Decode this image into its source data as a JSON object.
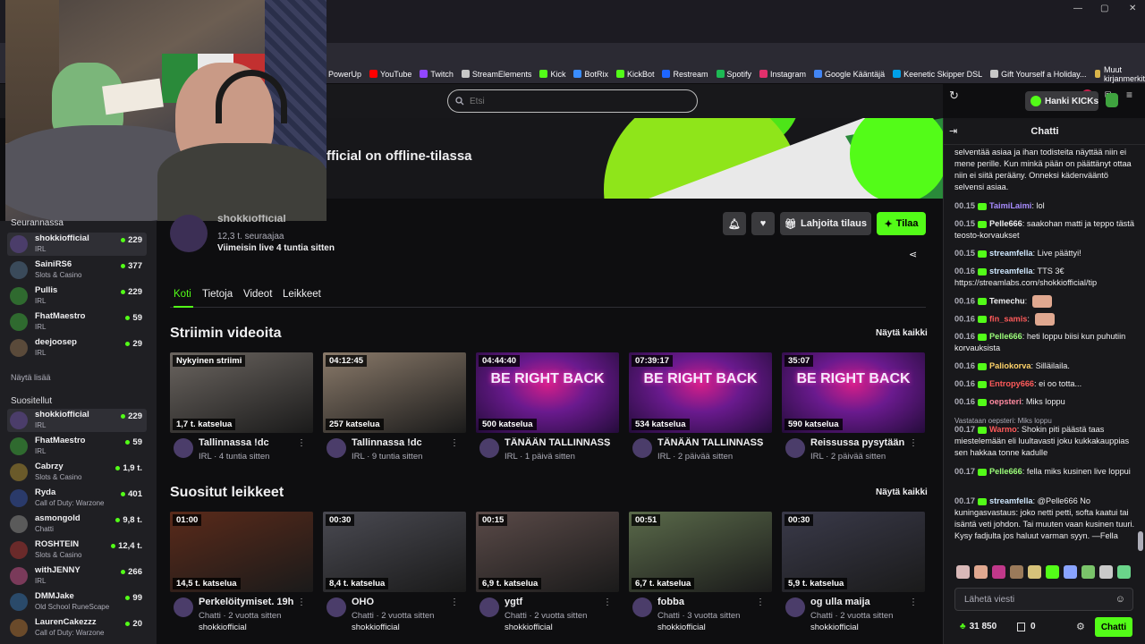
{
  "bookmarks": [
    {
      "label": "PowerUp",
      "color": "#f5a623"
    },
    {
      "label": "YouTube",
      "color": "#ff0000"
    },
    {
      "label": "Twitch",
      "color": "#9146ff"
    },
    {
      "label": "StreamElements",
      "color": "#c7c7c7"
    },
    {
      "label": "Kick",
      "color": "#53fc18"
    },
    {
      "label": "BotRix",
      "color": "#3a8dff"
    },
    {
      "label": "KickBot",
      "color": "#53fc18"
    },
    {
      "label": "Restream",
      "color": "#1e66ff"
    },
    {
      "label": "Spotify",
      "color": "#1db954"
    },
    {
      "label": "Instagram",
      "color": "#e1306c"
    },
    {
      "label": "Google Kääntäjä",
      "color": "#4285f4"
    },
    {
      "label": "Keenetic Skipper DSL",
      "color": "#00a0e9"
    },
    {
      "label": "Gift Yourself a Holiday...",
      "color": "#c7c7c7"
    }
  ],
  "bookmarks_other": "Muut kirjanmerkit",
  "ext_badge": "10",
  "search": {
    "placeholder": "Etsi"
  },
  "header": {
    "kicks_label": "Hanki KICKs"
  },
  "sidebar": {
    "following_title": "Seurannassa",
    "following": [
      {
        "name": "shokkiofficial",
        "category": "IRL",
        "viewers": "229",
        "color": "#4b3d6a"
      },
      {
        "name": "SainiRS6",
        "category": "Slots & Casino",
        "viewers": "377",
        "color": "#3a4a5a"
      },
      {
        "name": "Pullis",
        "category": "IRL",
        "viewers": "229",
        "color": "#2f6a2f"
      },
      {
        "name": "FhatMaestro",
        "category": "IRL",
        "viewers": "59",
        "color": "#2f6a2f"
      },
      {
        "name": "deejoosep",
        "category": "IRL",
        "viewers": "29",
        "color": "#5a4a3a"
      }
    ],
    "show_more": "Näytä lisää",
    "recommended_title": "Suositellut",
    "recommended": [
      {
        "name": "shokkiofficial",
        "category": "IRL",
        "viewers": "229",
        "color": "#4b3d6a"
      },
      {
        "name": "FhatMaestro",
        "category": "IRL",
        "viewers": "59",
        "color": "#2f6a2f"
      },
      {
        "name": "Cabrzy",
        "category": "Slots & Casino",
        "viewers": "1,9 t.",
        "color": "#6a5a2a"
      },
      {
        "name": "Ryda",
        "category": "Call of Duty: Warzone",
        "viewers": "401",
        "color": "#2a3a6a"
      },
      {
        "name": "asmongold",
        "category": "Chatti",
        "viewers": "9,8 t.",
        "color": "#5a5a5a"
      },
      {
        "name": "ROSHTEIN",
        "category": "Slots & Casino",
        "viewers": "12,4 t.",
        "color": "#6a2a2a"
      },
      {
        "name": "withJENNY",
        "category": "IRL",
        "viewers": "266",
        "color": "#7a3a5a"
      },
      {
        "name": "DMMJake",
        "category": "Old School RuneScape",
        "viewers": "99",
        "color": "#2a4a6a"
      },
      {
        "name": "LaurenCakezzz",
        "category": "Call of Duty: Warzone",
        "viewers": "20",
        "color": "#6a4a2a"
      }
    ]
  },
  "channel": {
    "offline_text": "fficial on offline-tilassa",
    "name": "shokkiofficial",
    "followers": "12,3 t. seuraajaa",
    "last_live": "Viimeisin live 4 tuntia sitten",
    "gift_sub": "Lahjoita tilaus",
    "subscribe": "Tilaa"
  },
  "tabs": [
    "Koti",
    "Tietoja",
    "Videot",
    "Leikkeet"
  ],
  "videos": {
    "title": "Striimin videoita",
    "see_all": "Näytä kaikki",
    "items": [
      {
        "top": "Nykyinen striimi",
        "bottom": "1,7 t. katselua",
        "title": "Tallinnassa !dc",
        "meta": "IRL · 4 tuntia sitten",
        "thumb": "#6b6560",
        "rb": false
      },
      {
        "top": "04:12:45",
        "bottom": "257 katselua",
        "title": "Tallinnassa !dc",
        "meta": "IRL · 9 tuntia sitten",
        "thumb": "#8a7a6a",
        "rb": false
      },
      {
        "top": "04:44:40",
        "bottom": "500 katselua",
        "title": "TÄNÄÄN TALLINNASSA",
        "meta": "IRL · 1 päivä sitten",
        "thumb": "",
        "rb": true
      },
      {
        "top": "07:39:17",
        "bottom": "534 katselua",
        "title": "TÄNÄÄN TALLINNASSA",
        "meta": "IRL · 2 päivää sitten",
        "thumb": "",
        "rb": true
      },
      {
        "top": "35:07",
        "bottom": "590 katselua",
        "title": "Reissussa pysytään",
        "meta": "IRL · 2 päivää sitten",
        "thumb": "",
        "rb": true
      }
    ],
    "rb_text": "BE RIGHT BACK"
  },
  "clips": {
    "title": "Suositut leikkeet",
    "see_all": "Näytä kaikki",
    "items": [
      {
        "top": "01:00",
        "bottom": "14,5 t. katselua",
        "title": "Perkelöitymiset. 19h",
        "meta": "Chatti · 2 vuotta sitten",
        "channel": "shokkiofficial",
        "thumb": "#5a2a1a"
      },
      {
        "top": "00:30",
        "bottom": "8,4 t. katselua",
        "title": "OHO",
        "meta": "Chatti · 2 vuotta sitten",
        "channel": "shokkiofficial",
        "thumb": "#4a4a52"
      },
      {
        "top": "00:15",
        "bottom": "6,9 t. katselua",
        "title": "ygtf",
        "meta": "Chatti · 2 vuotta sitten",
        "channel": "shokkiofficial",
        "thumb": "#5a4a48"
      },
      {
        "top": "00:51",
        "bottom": "6,7 t. katselua",
        "title": "fobba",
        "meta": "Chatti · 3 vuotta sitten",
        "channel": "shokkiofficial",
        "thumb": "#5a6a4a"
      },
      {
        "top": "00:30",
        "bottom": "5,9 t. katselua",
        "title": "og ulla maija",
        "meta": "Chatti · 2 vuotta sitten",
        "channel": "shokkiofficial",
        "thumb": "#3a3a4a"
      }
    ]
  },
  "chat": {
    "title": "Chatti",
    "first_text": "selventää asiaa ja ihan todisteita näyttää niin ei mene perille. Kun minkä pään on päättänyt ottaa niin ei siitä perääny. Onneksi kädenvääntö selvensi asiaa.",
    "messages": [
      {
        "time": "00.15",
        "user": "TaimiLaimi",
        "color": "#a88cff",
        "text": "lol"
      },
      {
        "time": "00.15",
        "user": "Pelle666",
        "color": "#efeff1",
        "text": "saakohan matti ja teppo tästä teosto-korvaukset"
      },
      {
        "time": "00.15",
        "user": "streamfella",
        "color": "#cfe8ff",
        "text": "Live päättyi!"
      },
      {
        "time": "00.16",
        "user": "streamfella",
        "color": "#cfe8ff",
        "text": "TTS 3€ https://streamlabs.com/shokkiofficial/tip"
      },
      {
        "time": "00.16",
        "user": "Temechu",
        "color": "#efeff1",
        "text": ""
      },
      {
        "time": "00.16",
        "user": "fin_samis",
        "color": "#ff5a5a",
        "text": ""
      },
      {
        "time": "00.16",
        "user": "Pelle666",
        "color": "#9cff7a",
        "text": "heti loppu biisi kun puhutiin korvauksista"
      },
      {
        "time": "00.16",
        "user": "Paliokorva",
        "color": "#ffd36a",
        "text": "Silläilaila."
      },
      {
        "time": "00.16",
        "user": "Entropy666",
        "color": "#ff5a5a",
        "text": "ei oo totta..."
      },
      {
        "time": "00.16",
        "user": "oepsteri",
        "color": "#ff8aa0",
        "text": "Miks loppu"
      },
      {
        "time": "00.17",
        "user": "Warmo",
        "color": "#ff5a5a",
        "text": "Shokin piti päästä taas miestelemään eli luultavasti joku kukkakauppias sen hakkaa tonne kadulle"
      },
      {
        "time": "00.17",
        "user": "Pelle666",
        "color": "#9cff7a",
        "text": "fella miks kusinen live loppui"
      },
      {
        "time": "00.17",
        "user": "streamfella",
        "color": "#cfe8ff",
        "text": "@Pelle666 No kuningasvastaus: joko netti petti, softa kaatui tai isäntä veti johdon. Tai muuten vaan kusinen tuuri. Kysy fadjulta jos haluut varman syyn. —Fella"
      }
    ],
    "reply_to": "Vastataan oepsteri: Miks loppu",
    "input_placeholder": "Lähetä viesti",
    "points": "31 850",
    "zero": "0",
    "send": "Chatti"
  }
}
